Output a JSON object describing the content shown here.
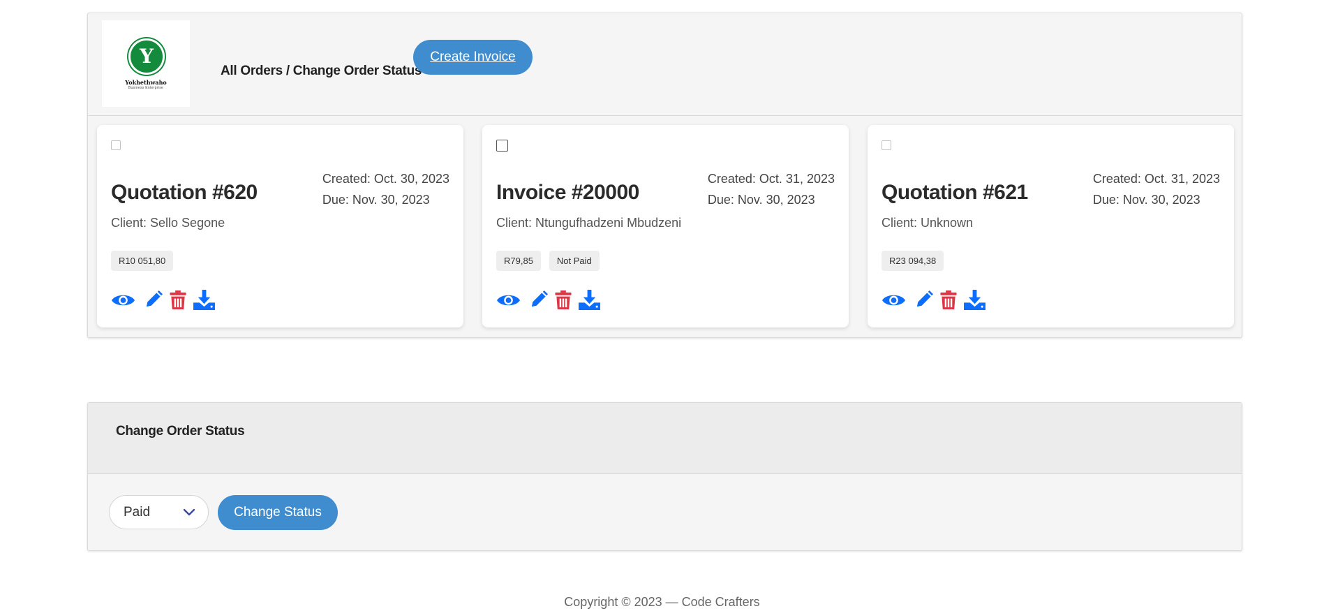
{
  "header": {
    "logo": {
      "letter": "Y",
      "name": "Yokhethwaho",
      "tagline": "Business Enterprise"
    },
    "breadcrumb": "All Orders / Change Order Status",
    "create_invoice_label": "Create Invoice"
  },
  "cards": [
    {
      "title": "Quotation #620",
      "created": "Created: Oct. 30, 2023",
      "due": "Due: Nov. 30, 2023",
      "client": "Client: Sello Segone",
      "amount": "R10 051,80",
      "status": ""
    },
    {
      "title": "Invoice #20000",
      "created": "Created: Oct. 31, 2023",
      "due": "Due: Nov. 30, 2023",
      "client": "Client: Ntungufhadzeni Mbudzeni",
      "amount": "R79,85",
      "status": "Not Paid"
    },
    {
      "title": "Quotation #621",
      "created": "Created: Oct. 31, 2023",
      "due": "Due: Nov. 30, 2023",
      "client": "Client: Unknown",
      "amount": "R23 094,38",
      "status": ""
    }
  ],
  "card_actions": [
    "eye-icon",
    "pencil-icon",
    "trash-icon",
    "download-icon"
  ],
  "status_section": {
    "title": "Change Order Status",
    "selected_status": "Paid",
    "button_label": "Change Status"
  },
  "footer": {
    "text": "Copyright © 2023 — Code Crafters"
  },
  "colors": {
    "accent": "#3f8ccf",
    "icon_blue": "#0d6efd",
    "icon_red": "#dc3545",
    "logo_green": "#138a3c"
  }
}
